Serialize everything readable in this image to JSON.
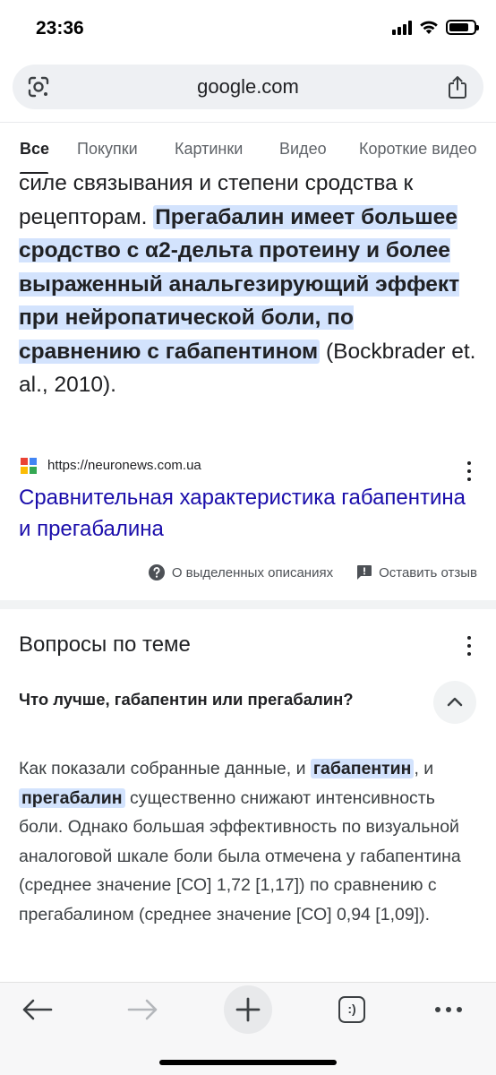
{
  "status": {
    "time": "23:36"
  },
  "browser": {
    "url": "google.com"
  },
  "tabs": [
    {
      "label": "Все"
    },
    {
      "label": "Покупки"
    },
    {
      "label": "Картинки"
    },
    {
      "label": "Видео"
    },
    {
      "label": "Короткие видео"
    }
  ],
  "snippet": {
    "line_top": "силе связывания и степени сродства к",
    "plain_start": "рецепторам. ",
    "highlight": "Прегабалин имеет большее сродство с α2-дельта протеину и более выраженный анальгезирующий эффект при нейропатической боли, по сравнению с габапентином",
    "plain_end": " (Bockbrader et. al., 2010)."
  },
  "source": {
    "url": "https://neuronews.com.ua",
    "title": "Сравнительная характеристика габапентина и прегабалина"
  },
  "about": {
    "featured_label": "О выделенных описаниях",
    "feedback_label": "Оставить отзыв"
  },
  "related": {
    "title": "Вопросы по теме",
    "question": "Что лучше, габапентин или прегабалин?",
    "answer_part1": "Как показали собранные данные, и ",
    "answer_hl1": "габапентин",
    "answer_part2": ", и ",
    "answer_hl2": "прегабалин",
    "answer_part3": " существенно снижают интенсивность боли. Однако большая эффективность по визуальной аналоговой шкале боли была отмечена у габапентина (среднее значение [СО] 1,72 [1,17]) по сравнению с прегабалином (среднее значение [СО] 0,94 [1,09])."
  },
  "toolbar": {
    "back": "arrow-left-icon",
    "forward": "arrow-right-icon",
    "new_tab": "plus-icon",
    "tabs_label": ":)",
    "more": "more-icon"
  },
  "colors": {
    "highlight": "#d3e3fd",
    "link": "#1a0dab"
  }
}
